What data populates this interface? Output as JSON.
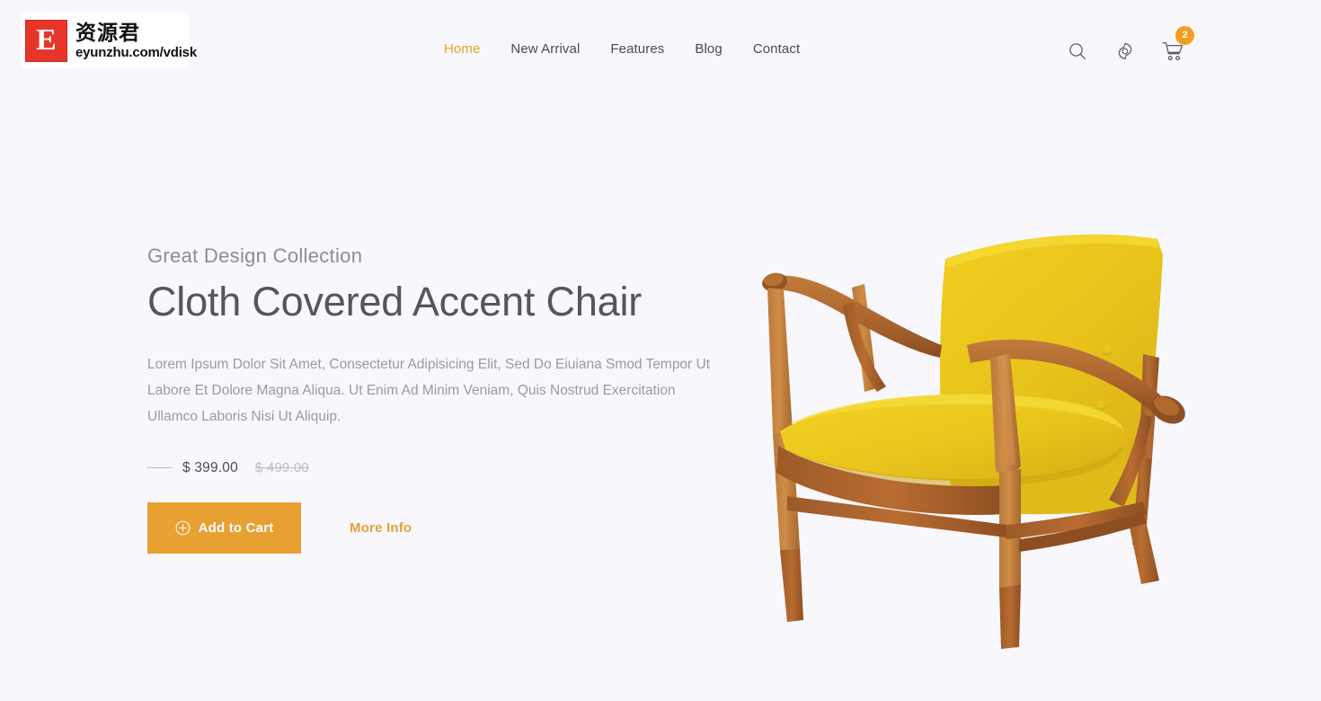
{
  "site": {
    "background_color": "#f8f7fc",
    "accent_color": "#e8a033",
    "accent_text_color": "#e8a020"
  },
  "header": {
    "logo": {
      "badge_letter": "E",
      "badge_color": "#e8352a",
      "chinese_name": "资源君",
      "url": "eyunzhu.com/vdisk"
    },
    "nav": [
      {
        "label": "Home",
        "active": true
      },
      {
        "label": "New Arrival",
        "active": false
      },
      {
        "label": "Features",
        "active": false
      },
      {
        "label": "Blog",
        "active": false
      },
      {
        "label": "Contact",
        "active": false
      }
    ],
    "icons": {
      "search": "search-icon",
      "settings": "gear-icon",
      "cart": "cart-icon"
    },
    "cart_badge_count": "2"
  },
  "hero": {
    "eyebrow": "Great Design Collection",
    "headline": "Cloth Covered Accent Chair",
    "description": "Lorem Ipsum Dolor Sit Amet, Consectetur Adipisicing Elit, Sed Do Eiuiana Smod Tempor Ut Labore Et Dolore Magna Aliqua. Ut Enim Ad Minim Veniam, Quis Nostrud Exercitation Ullamco Laboris Nisi Ut Aliquip.",
    "price_current": "$ 399.00",
    "price_original": "$ 499.00",
    "add_to_cart_label": "Add to Cart",
    "more_info_label": "More Info",
    "product_image": {
      "alt": "Mid-century modern lounge chair with yellow cloth upholstery and teak wood frame",
      "upholstery_color": "#e8c520",
      "wood_color": "#c07a35"
    }
  }
}
